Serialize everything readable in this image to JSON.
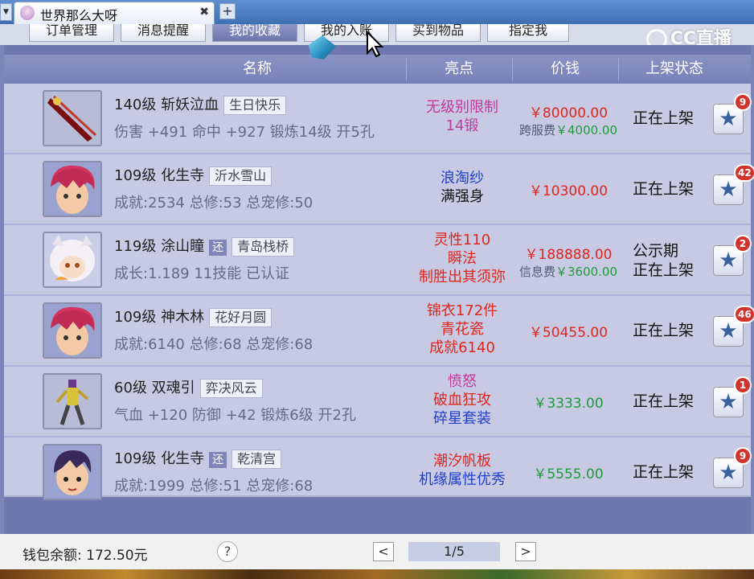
{
  "tab": {
    "title": "世界那么大呀",
    "close": "✖",
    "add": "+"
  },
  "watermark": "CC直播",
  "top_buttons": [
    "订单管理",
    "消息提醒",
    "我的收藏",
    "我的入账",
    "买到物品",
    "指定我"
  ],
  "table": {
    "headers": [
      "名称",
      "亮点",
      "价钱",
      "上架状态"
    ],
    "rows": [
      {
        "level_name": "140级  斩妖泣血",
        "tag": "生日快乐",
        "huan": "",
        "stats": "伤害 +491 命中 +927 锻炼14级 开5孔",
        "highlights": [
          {
            "text": "无级别限制",
            "color": "#c0399a"
          },
          {
            "text": "14锻",
            "color": "#c0399a"
          }
        ],
        "price": "￥80000.00",
        "price_color": "red",
        "fee_label": "跨服费",
        "fee": "￥4000.00",
        "status": [
          "正在上架"
        ],
        "fav_count": "9",
        "avatar": "weapon"
      },
      {
        "level_name": "109级  化生寺",
        "tag": "沂水雪山",
        "huan": "",
        "stats": "成就:2534 总修:53 总宠修:50",
        "highlights": [
          {
            "text": "浪淘纱",
            "color": "#1f3fc8"
          },
          {
            "text": "满强身",
            "color": "#111111"
          }
        ],
        "price": "￥10300.00",
        "price_color": "red",
        "fee_label": "",
        "fee": "",
        "status": [
          "正在上架"
        ],
        "fav_count": "42",
        "avatar": "redhair"
      },
      {
        "level_name": "119级  涂山瞳",
        "tag": "青岛栈桥",
        "huan": "还",
        "stats": "成长:1.189 11技能 已认证",
        "highlights": [
          {
            "text": "灵性110",
            "color": "#e0251d"
          },
          {
            "text": "瞬法",
            "color": "#e0251d"
          },
          {
            "text": "制胜出其须弥",
            "color": "#e0251d"
          }
        ],
        "price": "￥188888.00",
        "price_color": "red",
        "fee_label": "信息费",
        "fee": "￥3600.00",
        "status": [
          "公示期",
          "正在上架"
        ],
        "fav_count": "2",
        "avatar": "fox"
      },
      {
        "level_name": "109级  神木林",
        "tag": "花好月圆",
        "huan": "",
        "stats": "成就:6140 总修:68 总宠修:68",
        "highlights": [
          {
            "text": "锦衣172件",
            "color": "#e0251d"
          },
          {
            "text": "青花瓷",
            "color": "#e0251d"
          },
          {
            "text": "成就6140",
            "color": "#e0251d"
          }
        ],
        "price": "￥50455.00",
        "price_color": "red",
        "fee_label": "",
        "fee": "",
        "status": [
          "正在上架"
        ],
        "fav_count": "46",
        "avatar": "redhair"
      },
      {
        "level_name": "60级  双魂引",
        "tag": "弈决风云",
        "huan": "",
        "stats": "气血 +120 防御 +42 锻炼6级 开2孔",
        "highlights": [
          {
            "text": "愤怒",
            "color": "#c0399a"
          },
          {
            "text": "破血狂攻",
            "color": "#e0251d"
          },
          {
            "text": "碎星套装",
            "color": "#1f3fc8"
          }
        ],
        "price": "￥3333.00",
        "price_color": "green",
        "fee_label": "",
        "fee": "",
        "status": [
          "正在上架"
        ],
        "fav_count": "1",
        "avatar": "figure"
      },
      {
        "level_name": "109级  化生寺",
        "tag": "乾清宫",
        "huan": "还",
        "stats": "成就:1999 总修:51 总宠修:68",
        "highlights": [
          {
            "text": "潮汐帆板",
            "color": "#e0251d"
          },
          {
            "text": "机缘属性优秀",
            "color": "#1f3fc8"
          }
        ],
        "price": "￥5555.00",
        "price_color": "green",
        "fee_label": "",
        "fee": "",
        "status": [
          "正在上架"
        ],
        "fav_count": "9",
        "avatar": "darkhair"
      }
    ]
  },
  "footer": {
    "wallet": "钱包余额: 172.50元",
    "help": "?",
    "prev": "<",
    "page": "1/5",
    "next": ">"
  },
  "icons": {
    "favorite": "star-icon",
    "tab": "avatar-icon"
  }
}
